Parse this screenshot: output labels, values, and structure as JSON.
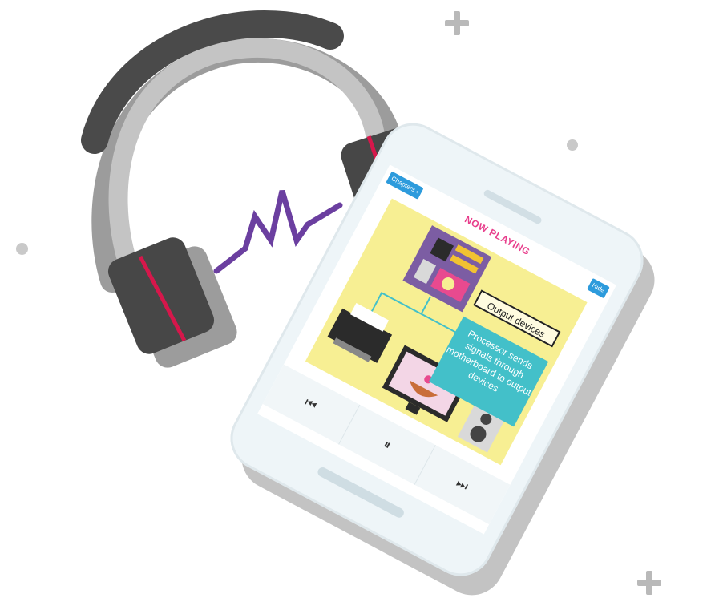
{
  "phone": {
    "app_bar": {
      "chapters_label": "Chapters ‹",
      "title": "NOW PLAYING",
      "hide_label": "Hide"
    },
    "slide": {
      "card_title": "Output devices",
      "card_body": "Processor sends signals through motherboard to output devices"
    },
    "controls": {
      "previous_icon": "⏮",
      "pause_icon": "⏸",
      "next_icon": "⏭"
    }
  },
  "icons": [
    "headphones-icon",
    "sound-wave-icon",
    "plus-icon",
    "dot-icon",
    "printer-icon",
    "monitor-icon",
    "speaker-icon",
    "motherboard-icon"
  ],
  "colors": {
    "headphone_band": "#4a4a4a",
    "headphone_shadow": "#9c9c9c",
    "accent_red": "#d6174b",
    "wave_purple": "#6b3fa0",
    "title_pink": "#e83e8c",
    "chip_blue": "#2d9bdc",
    "slide_yellow": "#f7ef93",
    "card_teal": "#43c0c9"
  }
}
